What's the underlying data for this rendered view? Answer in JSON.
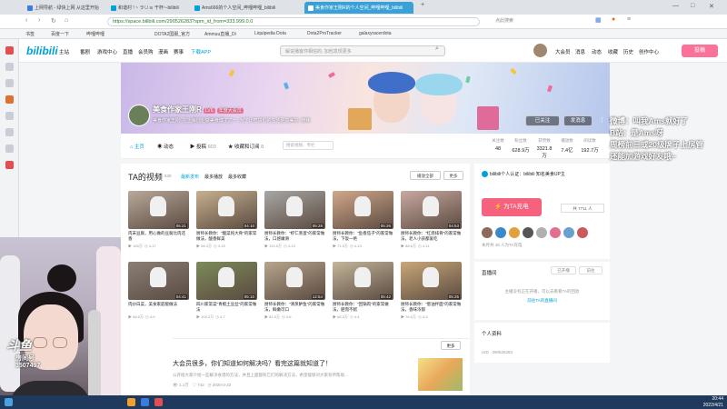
{
  "browser": {
    "tabs": [
      {
        "label": "上网导航 - 绿快上网 从这里开始",
        "color": "#3c7be0"
      },
      {
        "label": "和谐村 ! ~ ラ∪ョ 干杯~-bilibili",
        "color": "#00a1d6"
      },
      {
        "label": "Ams666的个人空间_哔哩哔哩_bilibili",
        "color": "#00a1d6"
      },
      {
        "label": "美食作家王刚R的个人空间_哔哩哔哩_bilibili",
        "color": "#00a1d6"
      }
    ],
    "active_tab_index": 3,
    "url": "https://space.bilibili.com/290526283?spm_id_from=333.999.0.0",
    "right_search": "点此搜索",
    "bookmarks": [
      "书签",
      "百度一下",
      "哔哩哔哩",
      "DOTA2国服_官方",
      "Ammuu直播_Di",
      "Liquipedia Dota",
      "Dota2ProTracker",
      "galaxyracerdota"
    ]
  },
  "bilibili": {
    "logo": "bilibili",
    "nav_items": [
      "主站",
      "番剧",
      "游戏中心",
      "直播",
      "会员购",
      "漫画",
      "赛事",
      "下载APP"
    ],
    "search_placeholder": "解说播客你相信的, 加他发现更多",
    "right_items": [
      "大会员",
      "消息",
      "动态",
      "收藏",
      "历史",
      "创作中心"
    ],
    "upload_label": "投稿"
  },
  "banner": {
    "username": "美食作家王刚R",
    "level_badge": "LV6",
    "vip_badge": "年度大会员",
    "signature": "美食作家王刚, 在上海创业做美食博主之一, 为了让吃货们的生活更加美好, 继续",
    "followed_label": "已关注",
    "message_label": "发消息"
  },
  "subnav": {
    "tabs": [
      {
        "label": "主页",
        "count": ""
      },
      {
        "label": "动态",
        "count": ""
      },
      {
        "label": "投稿",
        "count": "603"
      },
      {
        "label": "收藏和订阅",
        "count": "8"
      }
    ],
    "search_placeholder": "搜索视频、专栏",
    "stats": [
      {
        "label": "关注数",
        "value": "48"
      },
      {
        "label": "粉丝数",
        "value": "628.9万"
      },
      {
        "label": "获赞数",
        "value": "3321.8万"
      },
      {
        "label": "播放数",
        "value": "7.4亿"
      },
      {
        "label": "阅读数",
        "value": "192.7万"
      }
    ]
  },
  "videos": {
    "title": "TA的视频",
    "count": "539",
    "sorts": [
      "最新发布",
      "最多播放",
      "最多收藏"
    ],
    "play_all": "播放全部",
    "more": "更多",
    "items": [
      {
        "title": "肉末豆腐，用心做的豆腐比肉还香",
        "duration": "05:21",
        "views": "165万",
        "date": "4-17",
        "bg": "#b9a99a"
      },
      {
        "title": "厨师长教你：\"酸菜炖大骨\"的家常做法，酸香鲜美",
        "duration": "04:10",
        "views": "98.4万",
        "date": "4-15",
        "bg": "#c7b08e"
      },
      {
        "title": "厨师长教你：\"虾仁蒸蛋\"的家常做法，口感嫩滑",
        "duration": "05:28",
        "views": "113.5万",
        "date": "4-13",
        "bg": "#a8a6a4"
      },
      {
        "title": "厨师长教你：\"鱼香茄子\"的家常做法，下饭一绝",
        "duration": "05:26",
        "views": "71.9万",
        "date": "4-13",
        "bg": "#d1a88a"
      },
      {
        "title": "厨师长教你：\"红烧排骨\"的家常做法，老人小孩都爱吃",
        "duration": "04:53",
        "views": "88.6万",
        "date": "4-11",
        "bg": "#c8a9a0"
      },
      {
        "title": "肉炒白菜，美食家庭版做法",
        "duration": "04:41",
        "views": "68.6万",
        "date": "4-9",
        "bg": "#8a7f76"
      },
      {
        "title": "四川家常菜\"青椒土豆丝\"的家常做法",
        "duration": "05:10",
        "views": "105.2万",
        "date": "4-7",
        "bg": "#7c8a5a"
      },
      {
        "title": "厨师长教你：\"清蒸鲈鱼\"的家常做法，鲜嫩可口",
        "duration": "12:54",
        "views": "81.9万",
        "date": "4-6",
        "bg": "#b7a58c"
      },
      {
        "title": "厨师长教你：\"回锅肉\"的家常做法，肥而不腻",
        "duration": "05:42",
        "views": "66.3万",
        "date": "4-4",
        "bg": "#c4b59b"
      },
      {
        "title": "厨师长教你：\"葱油拌面\"的家常做法，香味浓郁",
        "duration": "05:25",
        "views": "76.5万",
        "date": "4-3",
        "bg": "#c9a878"
      }
    ]
  },
  "article": {
    "more": "更多",
    "title": "大会员很多，你们知道如何解决吗？看完这篇就知道了！",
    "desc": "公开给大家介绍一些解决食谱的方法，并且上面都有它们的解决方法，希望能够对大家有所帮助…",
    "views": "1.1万",
    "likes": "742",
    "date": "2020-3-22"
  },
  "sidebar": {
    "cert": "bilibili个人认证：bilibili 知名美食UP主",
    "charge_label": "为TA充电",
    "charge_count": "共 7711 人",
    "fans_count": "本月共 48 人为TA充电",
    "fan_colors": [
      "#8a6a5a",
      "#3a8ac8",
      "#e0a040",
      "#555555",
      "#b0b0b0",
      "#e07090",
      "#6aa0d0",
      "#c85a5a"
    ],
    "live_title": "直播间",
    "live_btn1": "已开播",
    "live_btn2": "前往",
    "live_text": "主播没有正在开播，可以去看看TA的回放",
    "live_link": "前往TA的直播间",
    "profile_title": "个人资料",
    "uid_label": "UID",
    "uid_value": "290526283"
  },
  "overlay": {
    "lines": [
      "微博：叫我Ams就好了",
      "B站：是Ams呀",
      "周榜前三或20级牌子上房管",
      "还能加游戏好友哦~"
    ]
  },
  "douyu": {
    "logo": "斗鱼",
    "room_label": "房间号",
    "room_number": "3507497"
  },
  "taskbar": {
    "time": "20:44",
    "date": "2022/4/21"
  }
}
